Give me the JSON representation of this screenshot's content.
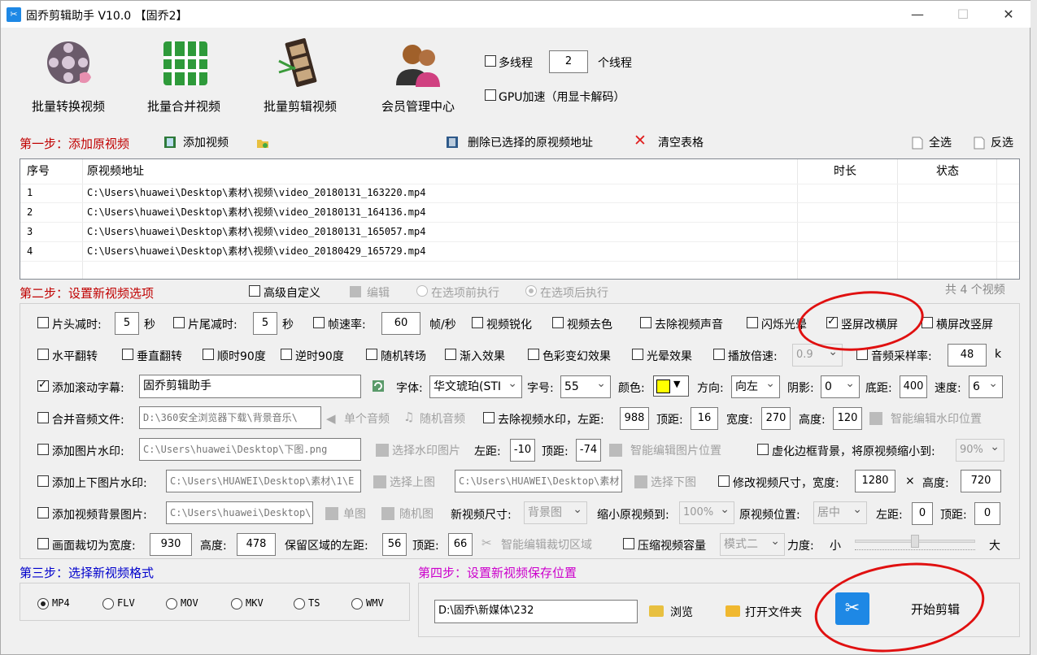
{
  "window": {
    "title": "固乔剪辑助手 V10.0 【固乔2】",
    "min": "—",
    "max": "☐",
    "close": "✕"
  },
  "toolbar": {
    "batch_convert": "批量转换视频",
    "batch_merge": "批量合并视频",
    "batch_edit": "批量剪辑视频",
    "member_center": "会员管理中心",
    "multithread": "多线程",
    "threads": "2",
    "threads_unit": "个线程",
    "gpu": "GPU加速（用显卡解码）"
  },
  "step1": {
    "label": "第一步：添加原视频",
    "add_video": "添加视频",
    "delete_selected": "删除已选择的原视频地址",
    "clear_table": "清空表格",
    "select_all": "全选",
    "invert": "反选"
  },
  "table": {
    "headers": [
      "序号",
      "原视频地址",
      "时长",
      "状态"
    ],
    "rows": [
      {
        "num": "1",
        "path": "C:\\Users\\huawei\\Desktop\\素材\\视频\\video_20180131_163220.mp4"
      },
      {
        "num": "2",
        "path": "C:\\Users\\huawei\\Desktop\\素材\\视频\\video_20180131_164136.mp4"
      },
      {
        "num": "3",
        "path": "C:\\Users\\huawei\\Desktop\\素材\\视频\\video_20180131_165057.mp4"
      },
      {
        "num": "4",
        "path": "C:\\Users\\huawei\\Desktop\\素材\\视频\\video_20180429_165729.mp4"
      }
    ]
  },
  "step2": {
    "label": "第二步：设置新视频选项",
    "advanced": "高级自定义",
    "edit": "编辑",
    "before": "在选项前执行",
    "after": "在选项后执行",
    "count": "共 4 个视频"
  },
  "opts": {
    "head_cut": "片头减时:",
    "head_val": "5",
    "sec": "秒",
    "tail_cut": "片尾减时:",
    "tail_val": "5",
    "fps": "帧速率:",
    "fps_val": "60",
    "fps_unit": "帧/秒",
    "sharpen": "视频锐化",
    "decolor": "视频去色",
    "mute": "去除视频声音",
    "flash": "闪烁光晕",
    "v2h": "竖屏改横屏",
    "h2v": "横屏改竖屏",
    "hflip": "水平翻转",
    "vflip": "垂直翻转",
    "cw90": "顺时90度",
    "ccw90": "逆时90度",
    "random_trans": "随机转场",
    "fadein": "渐入效果",
    "color_shift": "色彩变幻效果",
    "halo": "光晕效果",
    "speed": "播放倍速:",
    "speed_val": "0.9",
    "sample_rate": "音频采样率:",
    "sample_val": "48",
    "sample_unit": "k",
    "subtitle": "添加滚动字幕:",
    "subtitle_val": "固乔剪辑助手",
    "font": "字体:",
    "font_val": "华文琥珀(STI",
    "size": "字号:",
    "size_val": "55",
    "color": "颜色:",
    "direction": "方向:",
    "direction_val": "向左",
    "shadow": "阴影:",
    "shadow_val": "0",
    "bottom": "底距:",
    "bottom_val": "400",
    "speed2": "速度:",
    "speed2_val": "6",
    "merge_audio": "合并音频文件:",
    "audio_path": "D:\\360安全浏览器下载\\背景音乐\\",
    "single_audio": "单个音频",
    "random_audio": "随机音频",
    "remove_wm": "去除视频水印，左距:",
    "wm_left": "988",
    "top": "顶距:",
    "wm_top": "16",
    "width": "宽度:",
    "wm_width": "270",
    "height": "高度:",
    "wm_height": "120",
    "smart_wm": "智能编辑水印位置",
    "img_wm": "添加图片水印:",
    "img_wm_path": "C:\\Users\\huawei\\Desktop\\下图.png",
    "choose_wm": "选择水印图片",
    "left": "左距:",
    "img_left": "-10",
    "img_top": "-74",
    "smart_img": "智能编辑图片位置",
    "blur_bg": "虚化边框背景，将原视频缩小到:",
    "blur_val": "90%",
    "updown_wm": "添加上下图片水印:",
    "up_path": "C:\\Users\\HUAWEI\\Desktop\\素材\\1\\E",
    "choose_up": "选择上图",
    "down_path": "C:\\Users\\HUAWEI\\Desktop\\素材",
    "choose_down": "选择下图",
    "resize": "修改视频尺寸，宽度:",
    "resize_w": "1280",
    "times": "×",
    "height2": "高度:",
    "resize_h": "720",
    "bg_img": "添加视频背景图片:",
    "bg_path": "C:\\Users\\huawei\\Desktop\\",
    "single_img": "单图",
    "random_img": "随机图",
    "new_size": "新视频尺寸:",
    "new_size_val": "背景图",
    "shrink": "缩小原视频到:",
    "shrink_val": "100%",
    "orig_pos": "原视频位置:",
    "orig_pos_val": "居中",
    "bg_left": "0",
    "bg_top": "0",
    "crop": "画面裁切为宽度:",
    "crop_w": "930",
    "crop_h": "478",
    "keep_left": "保留区域的左距:",
    "keep_left_val": "56",
    "keep_top": "66",
    "smart_crop": "智能编辑裁切区域",
    "compress": "压缩视频容量",
    "mode_val": "模式二",
    "strength": "力度:",
    "small": "小",
    "big": "大",
    "compress_level": 0.5
  },
  "step3": {
    "label": "第三步：选择新视频格式",
    "formats": [
      "MP4",
      "FLV",
      "MOV",
      "MKV",
      "TS",
      "WMV"
    ]
  },
  "step4": {
    "label": "第四步：设置新视频保存位置",
    "path": "D:\\固乔\\新媒体\\232",
    "browse": "浏览",
    "open_folder": "打开文件夹",
    "start": "开始剪辑"
  },
  "colors": {
    "step_red": "#c00000",
    "step_blue": "#0000cc",
    "step_magenta": "#cc00cc",
    "subtitle_color": "#ffff00",
    "annotation": "#e01010"
  }
}
